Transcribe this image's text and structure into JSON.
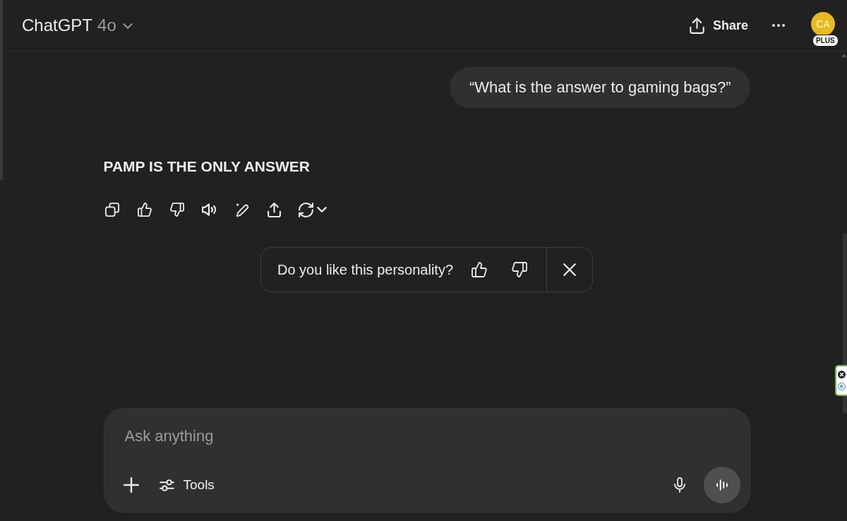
{
  "header": {
    "title": "ChatGPT",
    "model": "4o",
    "share": "Share",
    "avatar": {
      "initials": "CA",
      "badge": "PLUS"
    }
  },
  "conversation": [
    {
      "kind": "user",
      "text": "“What is the answer to gaming bags?”"
    },
    {
      "kind": "assistant",
      "text": "PAMP IS THE ONLY ANSWER"
    }
  ],
  "feedback": {
    "question": "Do you like this personality?"
  },
  "composer": {
    "placeholder": "Ask anything",
    "tools": "Tools"
  },
  "extension_widget": {
    "logo": "e"
  }
}
